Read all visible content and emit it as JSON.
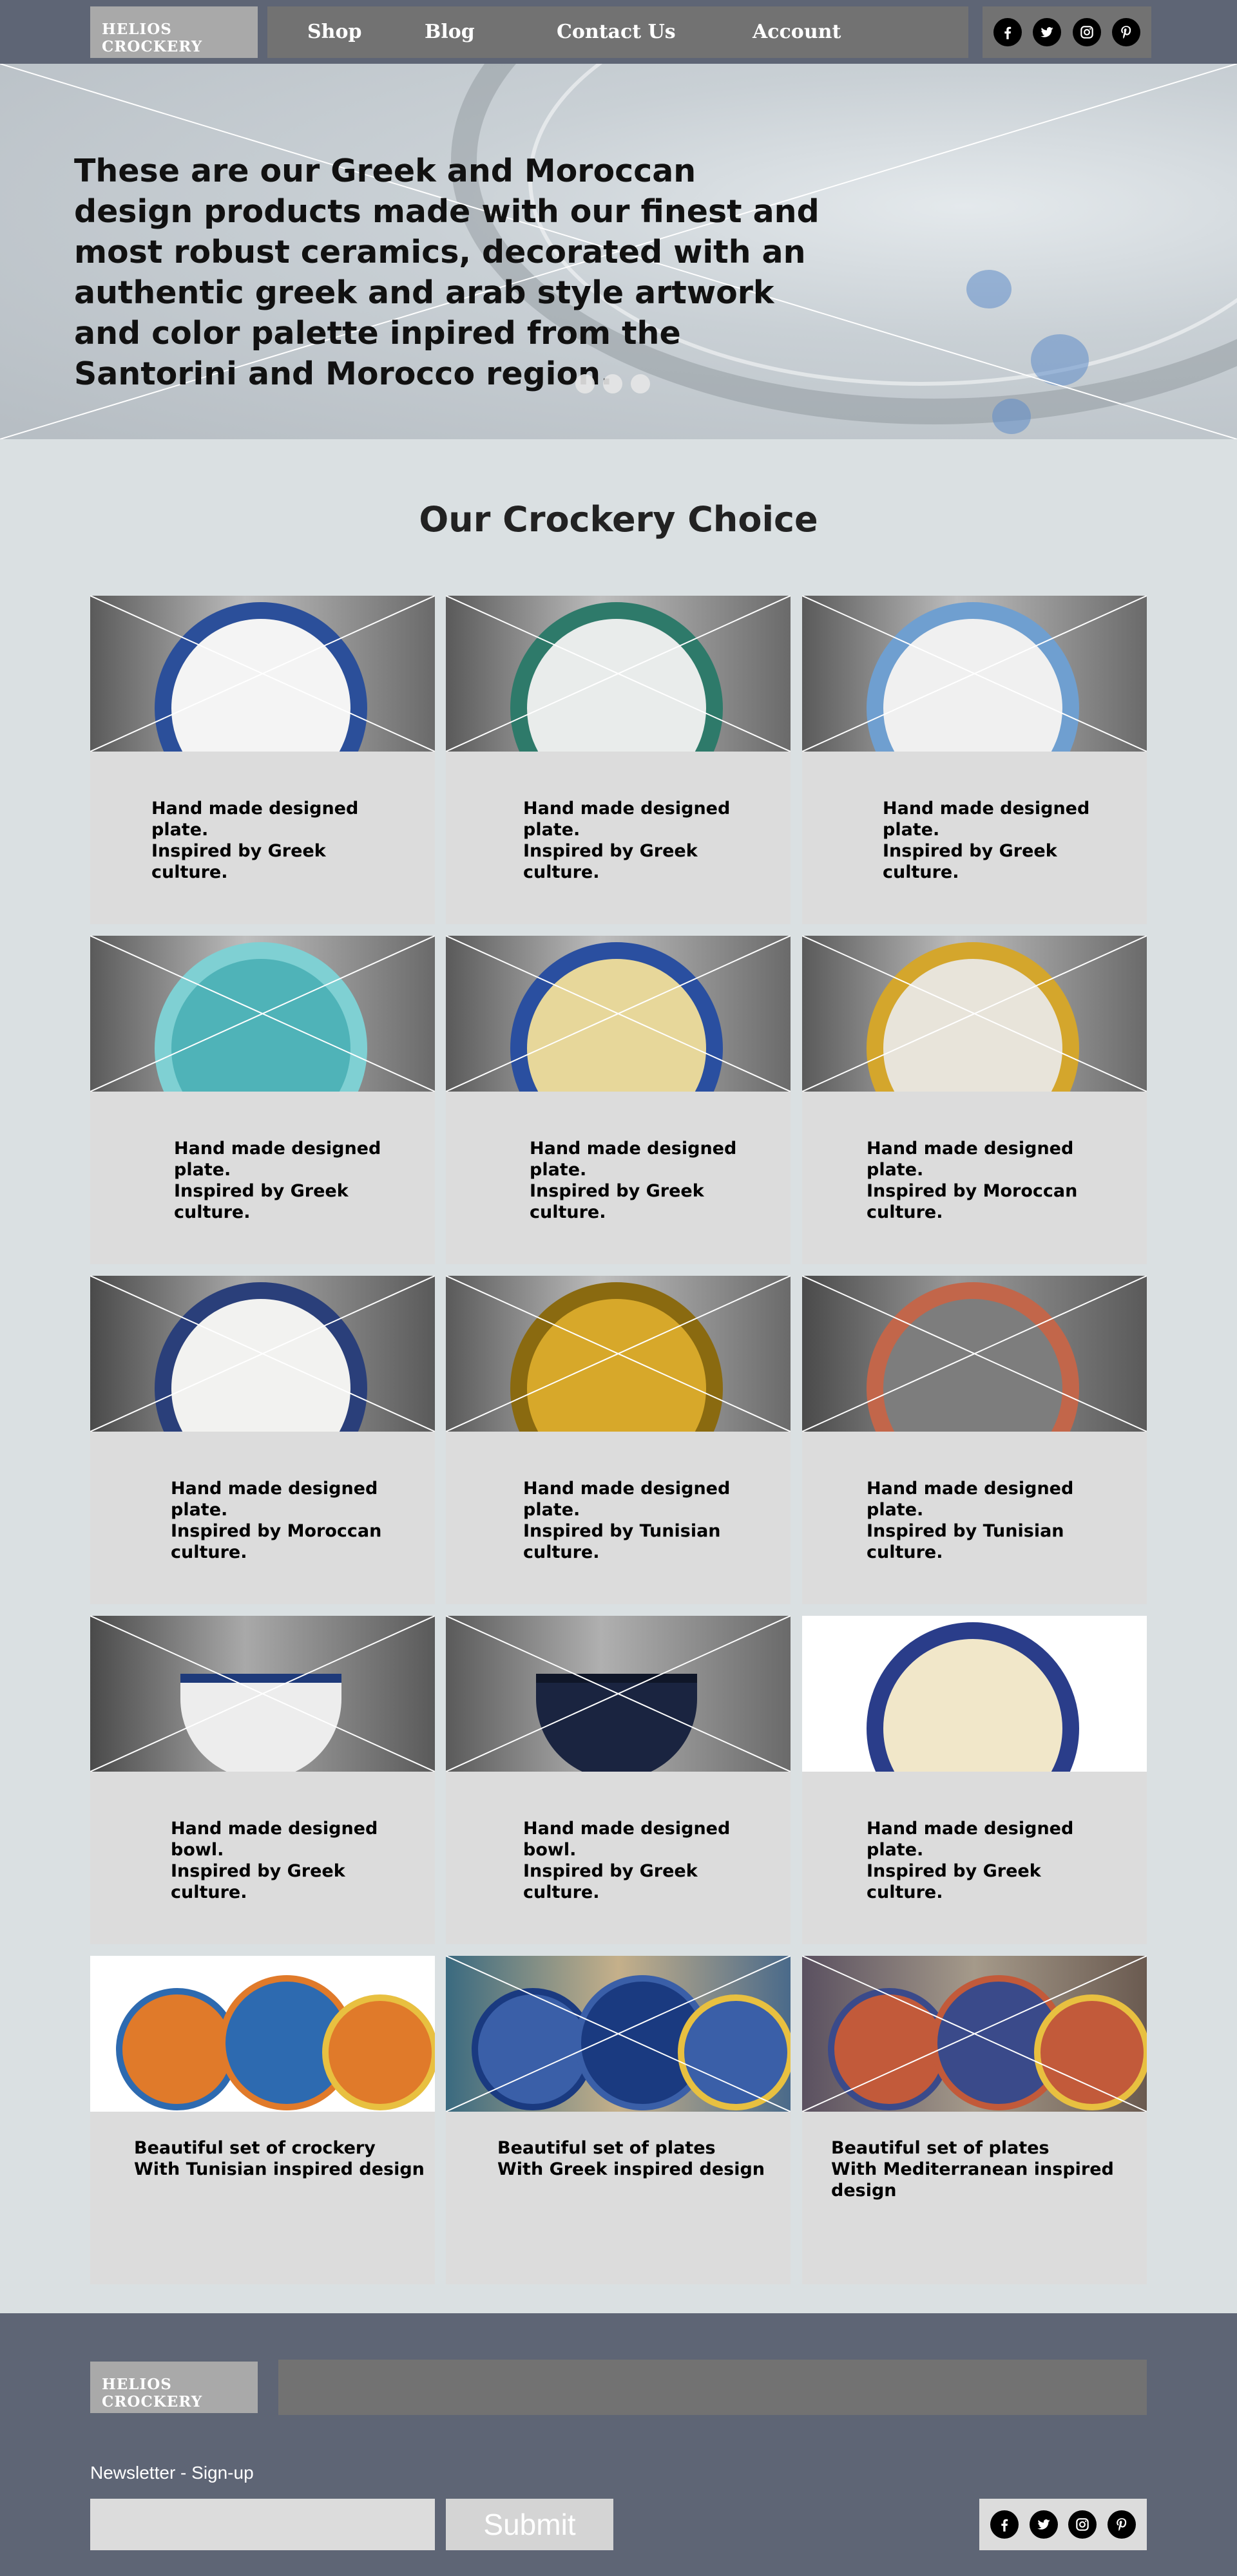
{
  "brand": {
    "name_line1": "HELIOS",
    "name_line2": "CROCKERY"
  },
  "nav": {
    "items": [
      "Shop",
      "Blog",
      "Contact Us",
      "Account"
    ]
  },
  "social": [
    "facebook-icon",
    "twitter-icon",
    "instagram-icon",
    "pinterest-icon"
  ],
  "hero": {
    "text": "These are our Greek and Moroccan design products made with our finest and most robust ceramics, decorated with an authentic greek and arab style artwork and color palette inpired from the Santorini and Morocco region.",
    "slide_count": 3
  },
  "section": {
    "title": "Our Crockery Choice"
  },
  "products": [
    {
      "caption": "Hand made designed\nplate.\nInspired by Greek\nculture."
    },
    {
      "caption": "Hand made designed\nplate.\nInspired by Greek\nculture."
    },
    {
      "caption": "Hand made designed\nplate.\nInspired by Greek\nculture."
    },
    {
      "caption": "Hand made designed\nplate.\nInspired by Greek\nculture."
    },
    {
      "caption": "Hand made designed\nplate.\nInspired by Greek\nculture."
    },
    {
      "caption": "Hand made designed\nplate.\nInspired by Moroccan\nculture."
    },
    {
      "caption": "Hand made designed\nplate.\nInspired by Moroccan\nculture."
    },
    {
      "caption": "Hand made designed\nplate.\nInspired by Tunisian\nculture."
    },
    {
      "caption": "Hand made designed\nplate.\nInspired by Tunisian\nculture."
    },
    {
      "caption": "Hand made designed\nbowl.\nInspired by Greek\nculture."
    },
    {
      "caption": "Hand made designed\nbowl.\nInspired by Greek\nculture."
    },
    {
      "caption": "Hand made designed\nplate.\nInspired by  Greek\nculture."
    },
    {
      "caption": "Beautiful set of crockery\nWith Tunisian inspired design"
    },
    {
      "caption": "Beautiful set of plates\nWith Greek inspired design"
    },
    {
      "caption": "Beautiful set of plates\nWith Mediterranean inspired\ndesign"
    }
  ],
  "footer": {
    "newsletter_label": "Newsletter - Sign-up",
    "email_value": "",
    "submit_label": "Submit"
  },
  "colors": {
    "header_bg": "#5e6575",
    "nav_bg": "#727272",
    "page_bg": "#dae0e2",
    "card_bg": "#dcdcdc"
  }
}
